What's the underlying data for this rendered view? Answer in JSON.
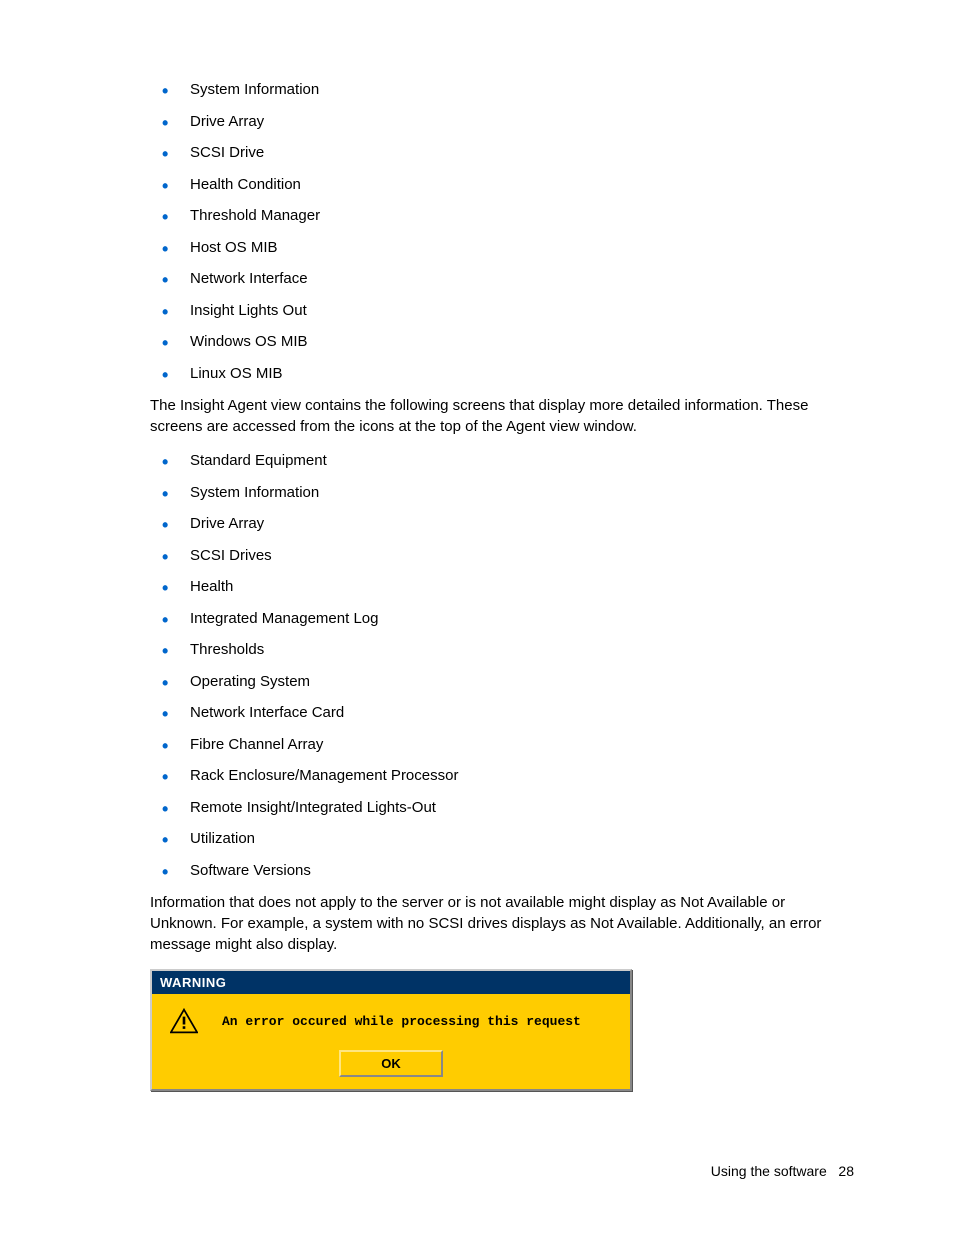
{
  "list1": [
    "System Information",
    "Drive Array",
    "SCSI Drive",
    "Health Condition",
    "Threshold Manager",
    "Host OS MIB",
    "Network Interface",
    "Insight Lights Out",
    "Windows OS MIB",
    "Linux OS MIB"
  ],
  "para1": "The Insight Agent view contains the following screens that display more detailed information. These screens are accessed from the icons at the top of the Agent view window.",
  "list2": [
    "Standard Equipment",
    "System Information",
    "Drive Array",
    "SCSI Drives",
    "Health",
    "Integrated Management Log",
    "Thresholds",
    "Operating System",
    "Network Interface Card",
    "Fibre Channel Array",
    "Rack Enclosure/Management Processor",
    "Remote Insight/Integrated Lights-Out",
    "Utilization",
    "Software Versions"
  ],
  "para2": "Information that does not apply to the server or is not available might display as Not Available or Unknown. For example, a system with no SCSI drives displays as Not Available. Additionally, an error message might also display.",
  "dialog": {
    "title": "WARNING",
    "message": "An error occured while processing this request",
    "ok": "OK"
  },
  "footer": {
    "section": "Using the software",
    "page": "28"
  }
}
